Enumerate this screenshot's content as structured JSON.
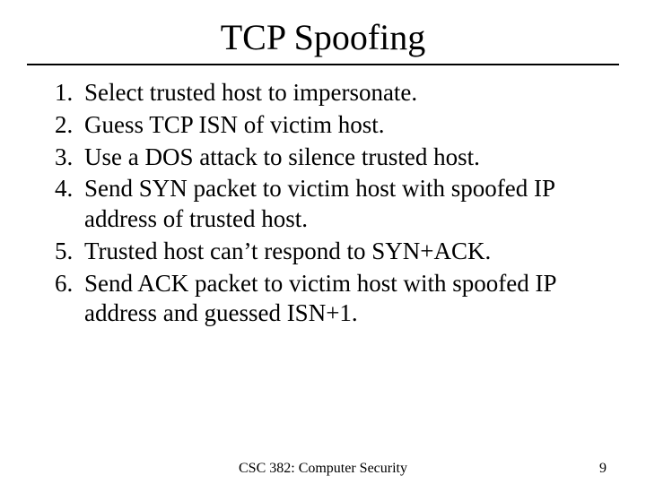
{
  "slide": {
    "title": "TCP Spoofing",
    "steps": [
      "Select trusted host to impersonate.",
      "Guess TCP ISN of victim host.",
      "Use a DOS attack to silence trusted host.",
      "Send SYN packet to victim host with spoofed IP address of trusted host.",
      "Trusted host can’t respond to SYN+ACK.",
      "Send ACK packet to victim host with spoofed IP address and guessed ISN+1."
    ],
    "footer": {
      "course": "CSC 382: Computer Security",
      "page": "9"
    }
  }
}
